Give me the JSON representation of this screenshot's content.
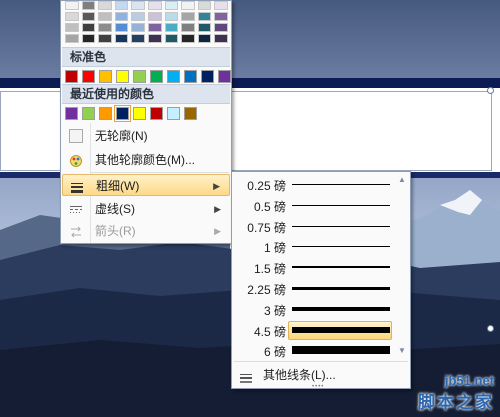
{
  "colors": {
    "theme_shades": [
      [
        "#f2f2f2",
        "#d8d8d8",
        "#bfbfbf",
        "#a5a5a5"
      ],
      [
        "#7f7f7f",
        "#595959",
        "#3f3f3f",
        "#262626"
      ],
      [
        "#d9d9d9",
        "#bfbfbf",
        "#8c8c8c",
        "#404040"
      ],
      [
        "#c6d9f0",
        "#8db3e2",
        "#548dd4",
        "#17365d"
      ],
      [
        "#dbe5f1",
        "#b8cce4",
        "#95b3d7",
        "#244061"
      ],
      [
        "#e5e0ec",
        "#ccc1d9",
        "#8064a2",
        "#3f3151"
      ],
      [
        "#dbeef3",
        "#b7dde8",
        "#4bacc6",
        "#205867"
      ],
      [
        "#f2f2f2",
        "#a5a5a5",
        "#7f7f7f",
        "#262626"
      ],
      [
        "#d9d9d9",
        "#31859b",
        "#215968",
        "#0f243e"
      ],
      [
        "#e5e0ec",
        "#8064a2",
        "#5f497a",
        "#3f3151"
      ]
    ],
    "standard": [
      "#c00000",
      "#ff0000",
      "#ffc000",
      "#ffff00",
      "#92d050",
      "#00b050",
      "#00b0f0",
      "#0070c0",
      "#002060",
      "#7030a0"
    ],
    "recent": [
      "#7030a0",
      "#92d050",
      "#ff9900",
      "#002060",
      "#ffff00",
      "#c00000",
      "#c6efff",
      "#996600"
    ],
    "recent_selected_index": 3,
    "hover_highlight": "#fdd987"
  },
  "menu": {
    "standard_colors_label": "标准色",
    "recent_colors_label": "最近使用的颜色",
    "no_outline": "无轮廓(N)",
    "more_outline_colors": "其他轮廓颜色(M)...",
    "weight": "粗细(W)",
    "dashes": "虚线(S)",
    "arrows": "箭头(R)"
  },
  "weights": [
    {
      "label": "0.25 磅",
      "pt": 0.25
    },
    {
      "label": "0.5 磅",
      "pt": 0.5
    },
    {
      "label": "0.75 磅",
      "pt": 0.75
    },
    {
      "label": "1 磅",
      "pt": 1
    },
    {
      "label": "1.5 磅",
      "pt": 1.5
    },
    {
      "label": "2.25 磅",
      "pt": 2.25
    },
    {
      "label": "3 磅",
      "pt": 3
    },
    {
      "label": "4.5 磅",
      "pt": 4.5
    },
    {
      "label": "6 磅",
      "pt": 6
    }
  ],
  "selected_weight_index": 7,
  "submenu": {
    "more_lines": "其他线条(L)..."
  },
  "watermark": {
    "url": "jb51.net",
    "name": "脚本之家"
  }
}
